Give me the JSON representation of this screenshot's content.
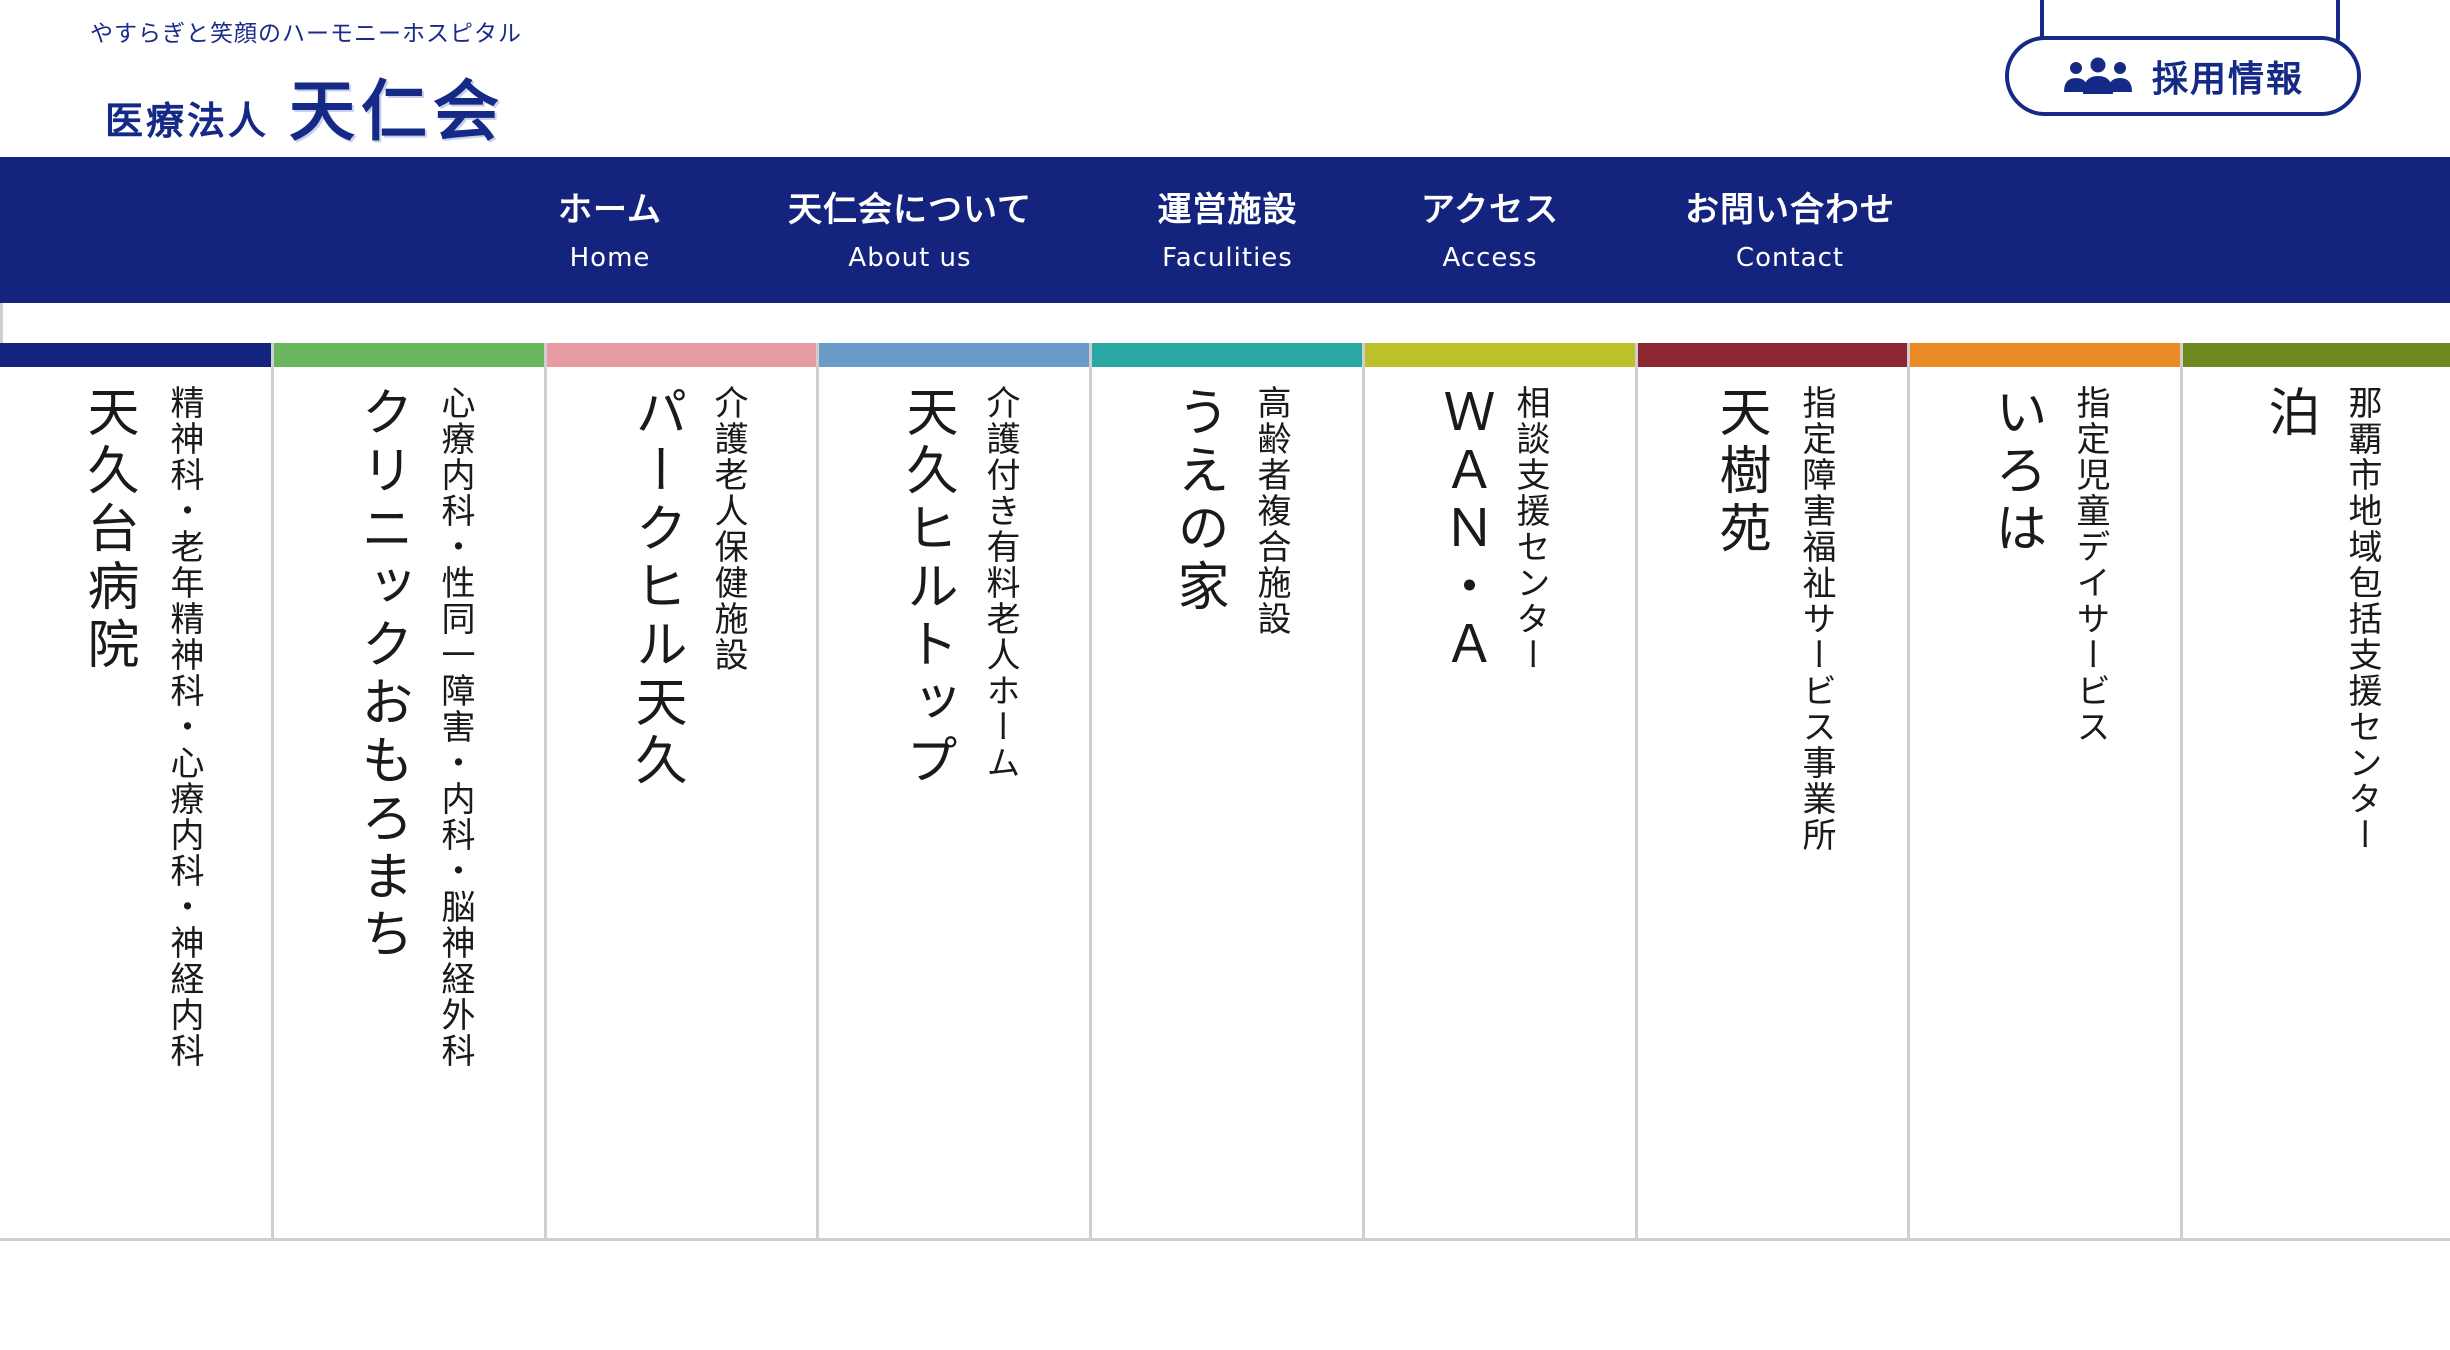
{
  "header": {
    "tagline": "やすらぎと笑顔のハーモニーホスピタル",
    "logo_prefix": "医療法人",
    "logo_main": "天仁会",
    "recruit_label": "採用情報"
  },
  "nav": {
    "items": [
      {
        "jp": "ホーム",
        "en": "Home"
      },
      {
        "jp": "天仁会について",
        "en": "About us"
      },
      {
        "jp": "運営施設",
        "en": "Faculities"
      },
      {
        "jp": "アクセス",
        "en": "Access"
      },
      {
        "jp": "お問い合わせ",
        "en": "Contact"
      }
    ]
  },
  "facilities": [
    {
      "name": "天久台病院",
      "desc": "精神科・老年精神科・心療内科・神経内科",
      "color": "#14247e"
    },
    {
      "name": "クリニックおもろまち",
      "desc": "心療内科・性同一障害・内科・脳神経外科",
      "color": "#6cb55f"
    },
    {
      "name": "パークヒル天久",
      "desc": "介護老人保健施設",
      "color": "#e79ca4"
    },
    {
      "name": "天久ヒルトップ",
      "desc": "介護付き有料老人ホーム",
      "color": "#6a9cc7"
    },
    {
      "name": "うえの家",
      "desc": "高齢者複合施設",
      "color": "#2aa8a4"
    },
    {
      "name": "ＷＡＮ・Ａ",
      "desc": "相談支援センター",
      "color": "#bcc02a"
    },
    {
      "name": "天樹苑",
      "desc": "指定障害福祉サービス事業所",
      "color": "#8c2630"
    },
    {
      "name": "いろは",
      "desc": "指定児童デイサービス",
      "color": "#e98a25"
    },
    {
      "name": "泊",
      "desc": "那覇市地域包括支援センター",
      "color": "#6e8a1f"
    }
  ]
}
